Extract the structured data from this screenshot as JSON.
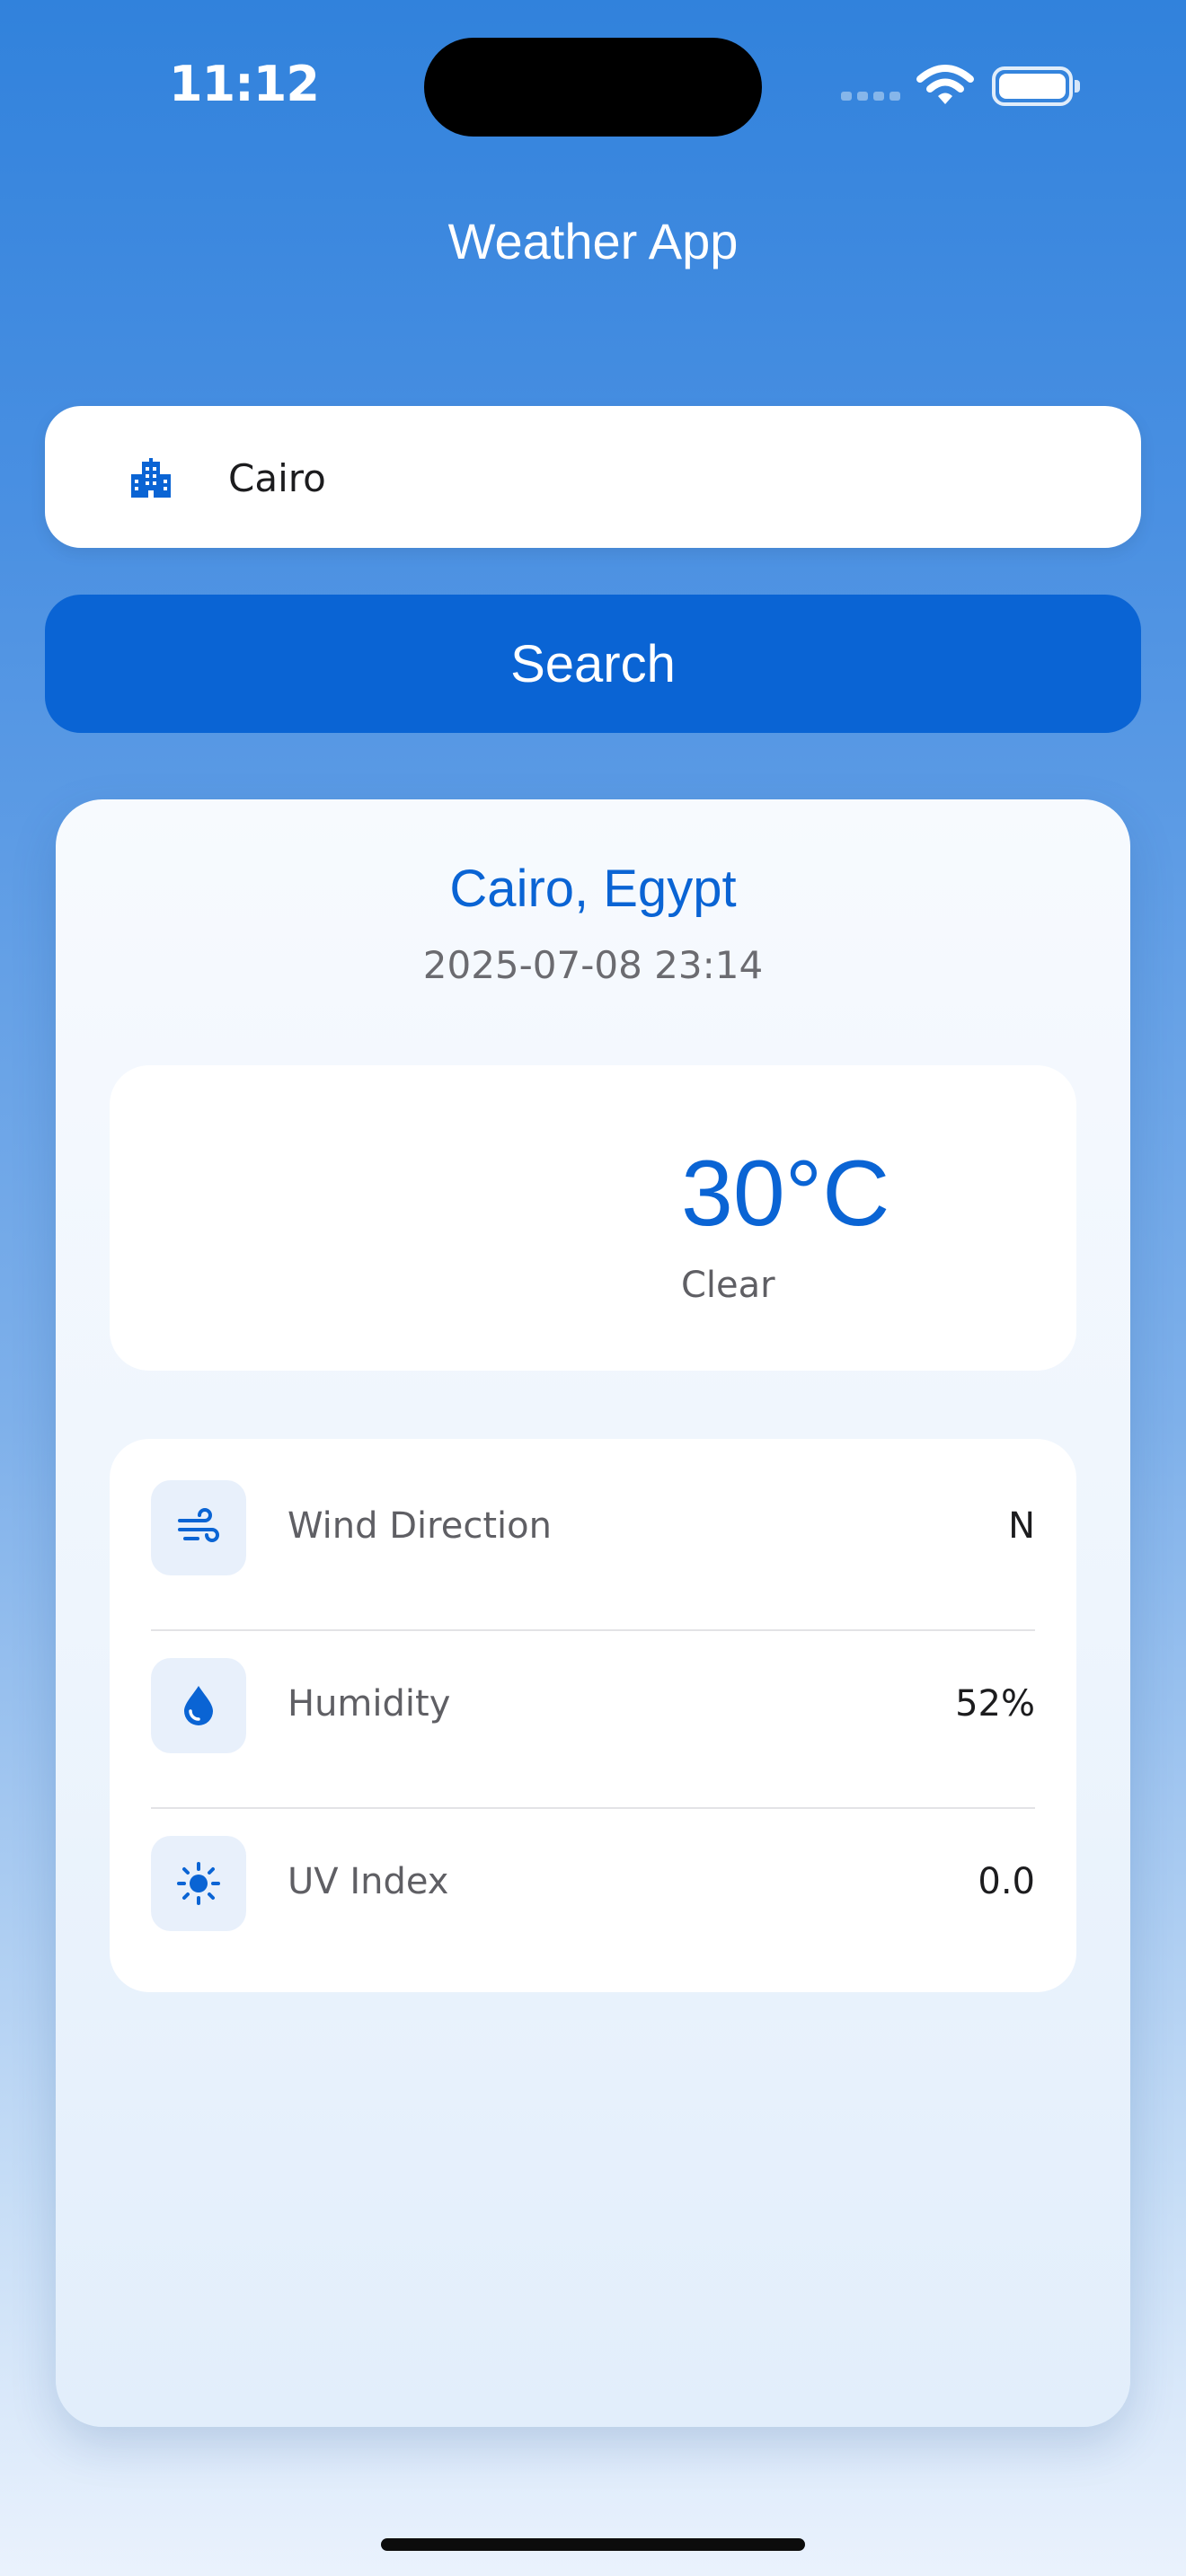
{
  "status_bar": {
    "time": "11:12"
  },
  "header": {
    "title": "Weather App"
  },
  "search": {
    "value": "Cairo",
    "button_label": "Search",
    "icon": "city-buildings-icon"
  },
  "result": {
    "location": "Cairo, Egypt",
    "datetime": "2025-07-08 23:14",
    "temperature": "30°C",
    "condition": "Clear",
    "condition_icon": "moon-icon",
    "details": [
      {
        "label": "Wind Direction",
        "value": "N",
        "icon": "wind-icon"
      },
      {
        "label": "Humidity",
        "value": "52%",
        "icon": "droplet-icon"
      },
      {
        "label": "UV Index",
        "value": "0.0",
        "icon": "sun-icon"
      }
    ]
  },
  "colors": {
    "accent": "#0a64d4",
    "tile": "#e8f0fb"
  }
}
